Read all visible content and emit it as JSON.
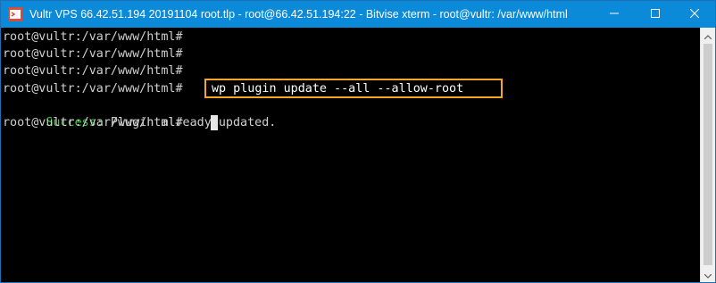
{
  "window": {
    "title": "Vultr VPS 66.42.51.194 20191104 root.tlp - root@66.42.51.194:22 - Bitvise xterm - root@vultr: /var/www/html",
    "icon": "terminal-app-icon",
    "controls": {
      "minimize": "minimize-icon",
      "maximize": "maximize-icon",
      "close": "close-icon"
    },
    "accent_color": "#0a8ad8"
  },
  "terminal": {
    "lines": [
      "root@vultr:/var/www/html#",
      "root@vultr:/var/www/html#",
      "root@vultr:/var/www/html#",
      "root@vultr:/var/www/html#"
    ],
    "highlighted_command": "wp plugin update --all --allow-root",
    "success_label": "Success:",
    "success_message": " Plugin already updated.",
    "prompt_line": "root@vultr:/var/www/html#",
    "colors": {
      "background": "#000000",
      "text": "#cfcfcf",
      "success": "#2fd12f",
      "highlight_box": "#f5a623"
    }
  },
  "scrollbar": {
    "up_icon": "scroll-up-arrow-icon",
    "down_icon": "scroll-down-arrow-icon"
  }
}
